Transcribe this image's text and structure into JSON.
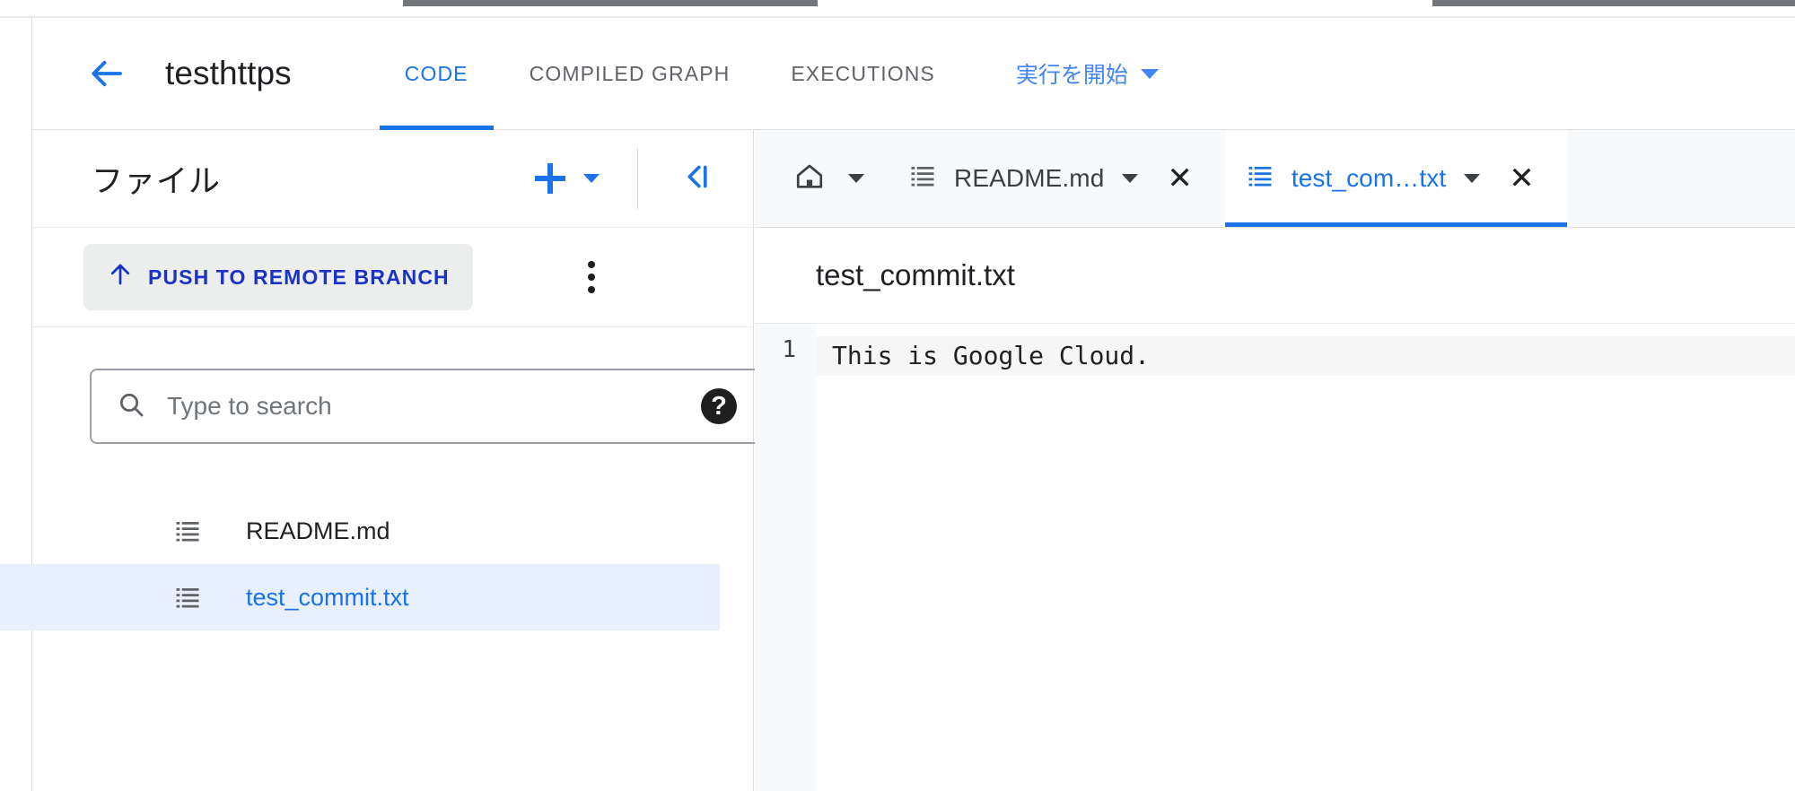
{
  "header": {
    "back_icon": "arrow-back-icon",
    "project_title": "testhttps",
    "tabs": [
      {
        "label": "CODE",
        "active": true
      },
      {
        "label": "COMPILED GRAPH",
        "active": false
      },
      {
        "label": "EXECUTIONS",
        "active": false
      }
    ],
    "run_button": {
      "label": "実行を開始",
      "dropdown_icon": "caret-down-icon"
    },
    "accent_color": "#1a73e8"
  },
  "sidebar": {
    "title": "ファイル",
    "add_button": {
      "icon": "plus-icon",
      "dropdown_icon": "caret-down-icon"
    },
    "collapse_icon": "collapse-panel-icon",
    "push_button": {
      "icon": "arrow-up-icon",
      "label": "PUSH TO REMOTE BRANCH",
      "text_color": "#1a33c4",
      "background": "#eceded"
    },
    "more_menu_icon": "kebab-menu-icon",
    "search": {
      "icon": "search-icon",
      "placeholder": "Type to search",
      "value": "",
      "help_icon": "help-filled-icon"
    },
    "files": [
      {
        "name": "README.md",
        "icon": "code-file-icon",
        "selected": false
      },
      {
        "name": "test_commit.txt",
        "icon": "code-file-icon",
        "selected": true
      }
    ],
    "selected_background": "#e8f0fe"
  },
  "editor": {
    "home_tab": {
      "icon": "home-icon",
      "dropdown_icon": "caret-down-icon"
    },
    "tabs": [
      {
        "label": "README.md",
        "icon": "code-file-icon",
        "dropdown_icon": "caret-down-icon",
        "close_icon": "close-icon",
        "active": false
      },
      {
        "label": "test_com…txt",
        "icon": "code-file-icon",
        "dropdown_icon": "caret-down-icon",
        "close_icon": "close-icon",
        "active": true
      }
    ],
    "file_title": "test_commit.txt",
    "code": {
      "lines": [
        {
          "number": "1",
          "text": "This is Google Cloud."
        }
      ]
    }
  }
}
